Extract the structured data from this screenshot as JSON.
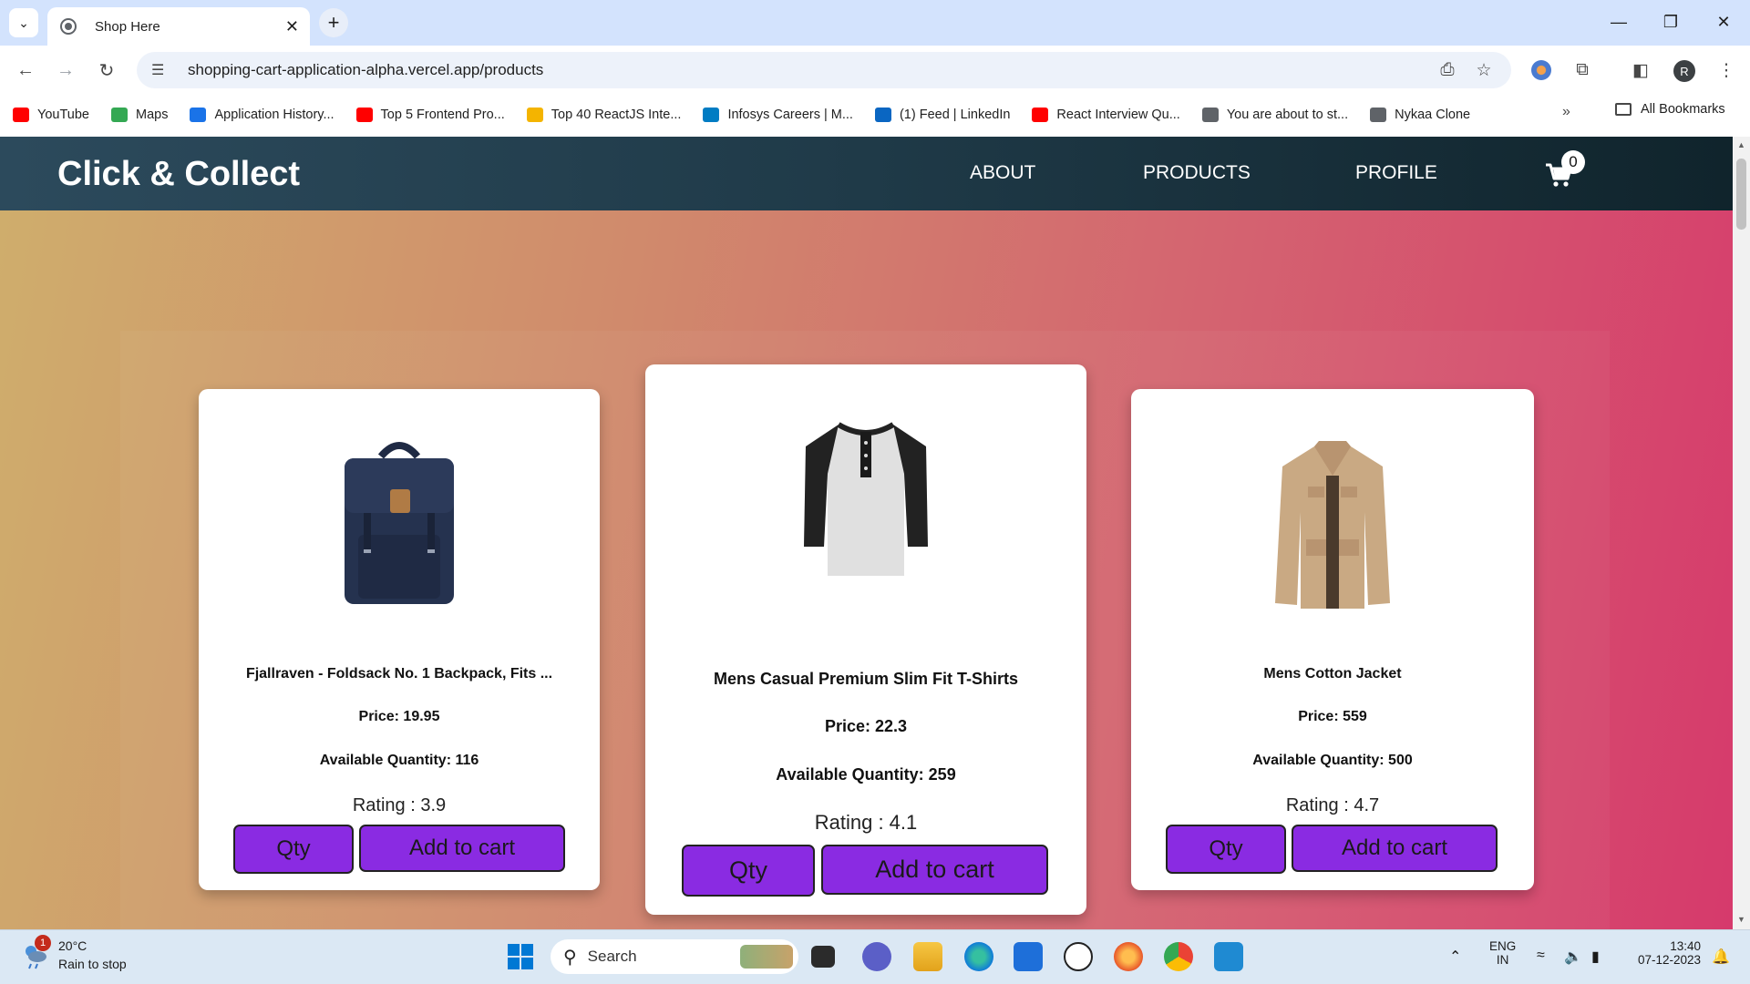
{
  "browser": {
    "tab_title": "Shop Here",
    "url": "shopping-cart-application-alpha.vercel.app/products",
    "profile_initial": "R",
    "bookmarks": [
      {
        "label": "YouTube",
        "icon": "youtube-icon",
        "color": "#ff0000"
      },
      {
        "label": "Maps",
        "icon": "maps-icon",
        "color": "#34a853"
      },
      {
        "label": "Application History...",
        "icon": "app-history-icon",
        "color": "#1a73e8"
      },
      {
        "label": "Top 5 Frontend Pro...",
        "icon": "youtube-icon",
        "color": "#ff0000"
      },
      {
        "label": "Top 40 ReactJS Inte...",
        "icon": "bookmark-site-icon",
        "color": "#f4b400"
      },
      {
        "label": "Infosys Careers | M...",
        "icon": "infosys-icon",
        "color": "#007cc3"
      },
      {
        "label": "(1) Feed | LinkedIn",
        "icon": "linkedin-icon",
        "color": "#0a66c2"
      },
      {
        "label": "React Interview Qu...",
        "icon": "youtube-icon",
        "color": "#ff0000"
      },
      {
        "label": "You are about to st...",
        "icon": "globe-icon",
        "color": "#5f6368"
      },
      {
        "label": "Nykaa Clone",
        "icon": "globe-icon",
        "color": "#5f6368"
      }
    ],
    "all_bookmarks": "All Bookmarks"
  },
  "app": {
    "brand": "Click & Collect",
    "nav": [
      "ABOUT",
      "PRODUCTS",
      "PROFILE"
    ],
    "cart_count": "0",
    "colors": {
      "header": "#1f3a48",
      "button": "#8a2be2"
    }
  },
  "products": [
    {
      "name": "Fjallraven - Foldsack No. 1 Backpack, Fits ...",
      "price": "Price: 19.95",
      "quantity": "Available Quantity: 116",
      "rating": "Rating : 3.9",
      "qty_label": "Qty",
      "add_label": "Add to cart",
      "image": "backpack-image"
    },
    {
      "name": "Mens Casual Premium Slim Fit T-Shirts",
      "price": "Price: 22.3",
      "quantity": "Available Quantity: 259",
      "rating": "Rating : 4.1",
      "qty_label": "Qty",
      "add_label": "Add to cart",
      "image": "tshirt-image"
    },
    {
      "name": "Mens Cotton Jacket",
      "price": "Price: 559",
      "quantity": "Available Quantity: 500",
      "rating": "Rating : 4.7",
      "qty_label": "Qty",
      "add_label": "Add to cart",
      "image": "jacket-image"
    }
  ],
  "taskbar": {
    "weather_temp": "20°C",
    "weather_desc": "Rain to stop",
    "weather_badge": "1",
    "search_label": "Search",
    "lang_top": "ENG",
    "lang_bottom": "IN",
    "time": "13:40",
    "date": "07-12-2023"
  }
}
